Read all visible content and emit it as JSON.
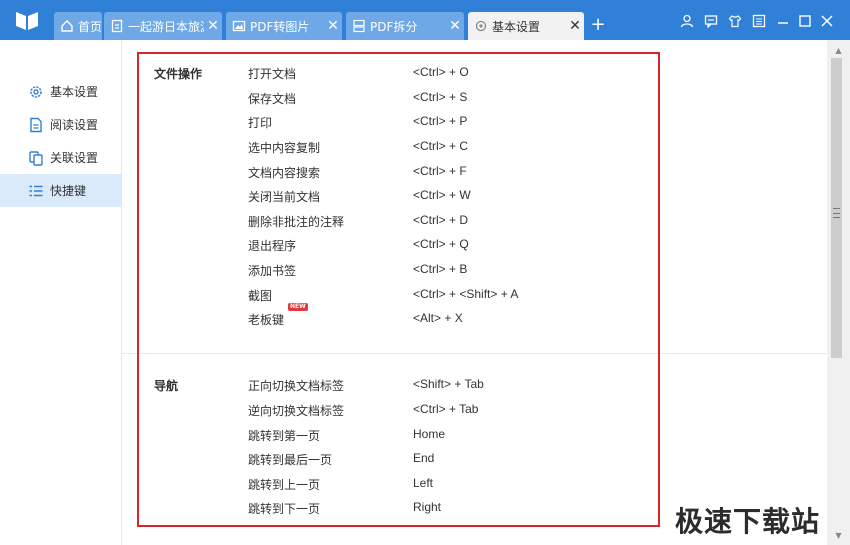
{
  "titlebar": {
    "tabs": [
      {
        "label": "首页",
        "icon": "home-icon"
      },
      {
        "label": "一起游日本旅游",
        "icon": "document-icon"
      },
      {
        "label": "PDF转图片",
        "icon": "pdf-image-icon"
      },
      {
        "label": "PDF拆分",
        "icon": "pdf-split-icon"
      },
      {
        "label": "基本设置",
        "icon": "settings-gear-icon",
        "active": true
      }
    ],
    "new_tab": "+",
    "close_glyph": "✕",
    "window_buttons": [
      "user-icon",
      "message-icon",
      "skin-icon",
      "menu-icon",
      "minimize-icon",
      "maximize-icon",
      "close-icon"
    ],
    "accent_color": "#2f80d6"
  },
  "sidebar": {
    "items": [
      {
        "label": "基本设置",
        "icon": "gear-icon"
      },
      {
        "label": "阅读设置",
        "icon": "read-doc-icon"
      },
      {
        "label": "关联设置",
        "icon": "link-doc-icon"
      },
      {
        "label": "快捷键",
        "icon": "shortcut-list-icon",
        "active": true
      }
    ]
  },
  "shortcuts": {
    "file": {
      "title": "文件操作",
      "rows": [
        {
          "action": "打开文档",
          "key": "<Ctrl> + O"
        },
        {
          "action": "保存文档",
          "key": "<Ctrl> + S"
        },
        {
          "action": "打印",
          "key": "<Ctrl> + P"
        },
        {
          "action": "选中内容复制",
          "key": "<Ctrl> + C"
        },
        {
          "action": "文档内容搜索",
          "key": "<Ctrl> + F"
        },
        {
          "action": "关闭当前文档",
          "key": "<Ctrl> + W"
        },
        {
          "action": "删除非批注的注释",
          "key": "<Ctrl> + D"
        },
        {
          "action": "退出程序",
          "key": "<Ctrl> + Q"
        },
        {
          "action": "添加书签",
          "key": "<Ctrl> + B"
        },
        {
          "action": "截图",
          "key": "<Ctrl> + <Shift> + A"
        },
        {
          "action": "老板键",
          "key": "<Alt> + X",
          "badge": "NEW"
        }
      ]
    },
    "nav": {
      "title": "导航",
      "rows": [
        {
          "action": "正向切换文档标签",
          "key": "<Shift> + Tab"
        },
        {
          "action": "逆向切换文档标签",
          "key": "<Ctrl> + Tab"
        },
        {
          "action": "跳转到第一页",
          "key": "Home"
        },
        {
          "action": "跳转到最后一页",
          "key": "End"
        },
        {
          "action": "跳转到上一页",
          "key": "Left"
        },
        {
          "action": "跳转到下一页",
          "key": "Right"
        }
      ]
    }
  },
  "highlight_color": "#d9262b",
  "watermark": "极速下载站"
}
